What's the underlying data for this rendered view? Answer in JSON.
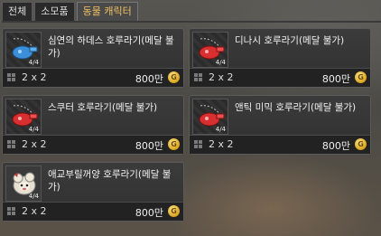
{
  "tabs": [
    {
      "label": "전체"
    },
    {
      "label": "소모품"
    },
    {
      "label": "동물 캐릭터"
    }
  ],
  "items": [
    {
      "name": "심연의 하데스 호루라기(메달 불가)",
      "qty": "4/4",
      "size": "2 x 2",
      "price": "800만",
      "icon": "whistle-blue-icon",
      "color": "#3a8fd8"
    },
    {
      "name": "디나시 호루라기(메달 불가)",
      "qty": "4/4",
      "size": "2 x 2",
      "price": "800만",
      "icon": "whistle-red-icon",
      "color": "#d83030"
    },
    {
      "name": "스쿠터 호루라기(메달 불가)",
      "qty": "4/4",
      "size": "2 x 2",
      "price": "800만",
      "icon": "whistle-red-icon",
      "color": "#d83030"
    },
    {
      "name": "앤틱 미믹 호루라기(메달 불가)",
      "qty": "4/4",
      "size": "2 x 2",
      "price": "800만",
      "icon": "whistle-red-icon",
      "color": "#d83030"
    },
    {
      "name": "애교부릴꺼양 호루라기(메달 불가)",
      "qty": "4/4",
      "size": "2 x 2",
      "price": "800만",
      "icon": "sheep-icon",
      "color": "#e8e0d0"
    }
  ]
}
